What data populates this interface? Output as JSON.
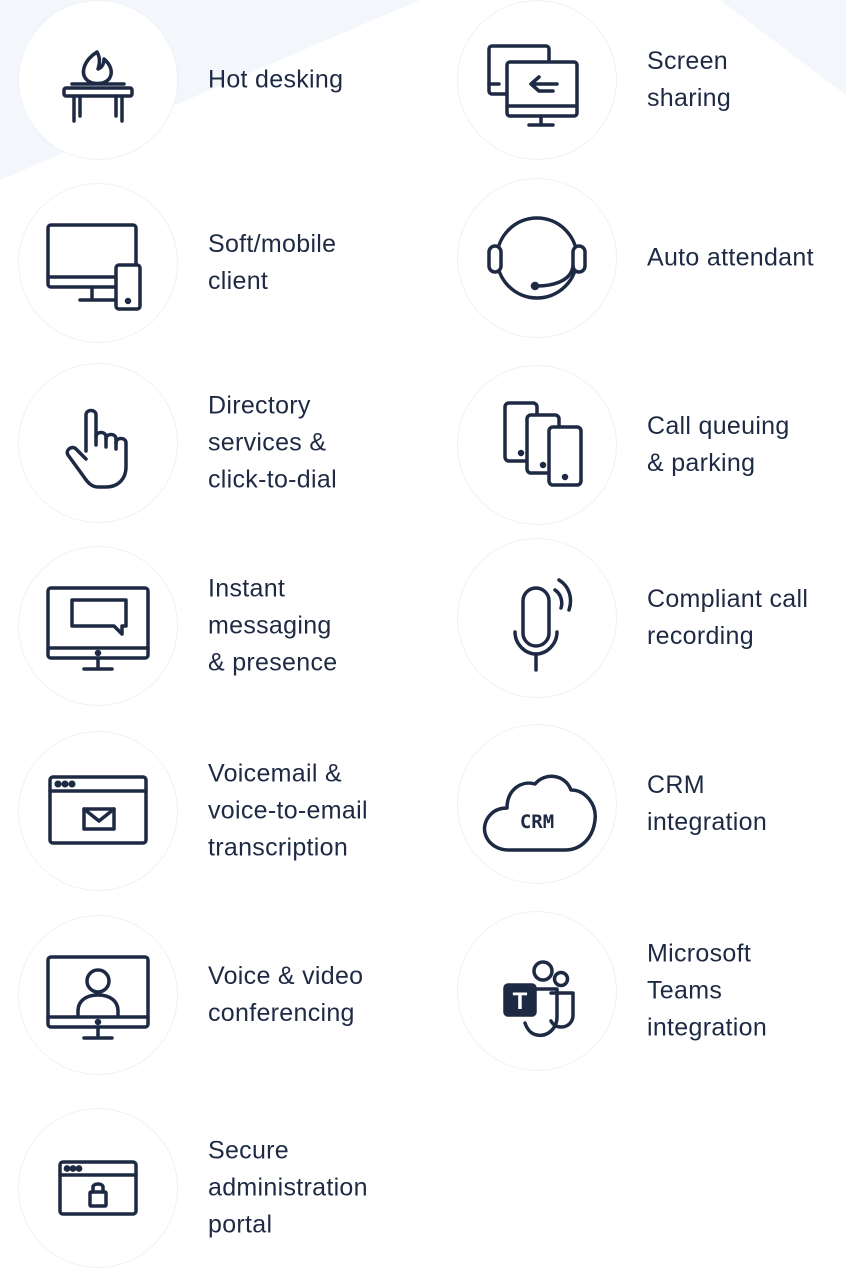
{
  "colors": {
    "text": "#1e2a44",
    "icon": "#1e2a44",
    "circle_background": "#ffffff",
    "page_background_tint": "#f3f6fb"
  },
  "features": [
    {
      "icon": "flame-on-table-icon",
      "lines": [
        "Hot desking"
      ]
    },
    {
      "icon": "screen-sharing-icon",
      "lines": [
        "Screen",
        "sharing"
      ]
    },
    {
      "icon": "monitor-and-phone-icon",
      "lines": [
        "Soft/mobile",
        "client"
      ]
    },
    {
      "icon": "headset-icon",
      "lines": [
        "Auto attendant"
      ]
    },
    {
      "icon": "pointing-hand-icon",
      "lines": [
        "Directory",
        "services &",
        "click-to-dial"
      ]
    },
    {
      "icon": "stacked-phones-icon",
      "lines": [
        "Call queuing",
        "& parking"
      ]
    },
    {
      "icon": "chat-monitor-icon",
      "lines": [
        "Instant",
        "messaging",
        "& presence"
      ]
    },
    {
      "icon": "microphone-icon",
      "lines": [
        "Compliant call",
        "recording"
      ]
    },
    {
      "icon": "email-window-icon",
      "lines": [
        "Voicemail &",
        "voice-to-email",
        "transcription"
      ]
    },
    {
      "icon": "crm-cloud-icon",
      "lines": [
        "CRM",
        "integration"
      ],
      "icon_text": "CRM"
    },
    {
      "icon": "video-call-monitor-icon",
      "lines": [
        "Voice & video",
        "conferencing"
      ]
    },
    {
      "icon": "microsoft-teams-icon",
      "lines": [
        "Microsoft",
        "Teams",
        "integration"
      ],
      "icon_text": "T"
    },
    {
      "icon": "secure-portal-icon",
      "lines": [
        "Secure",
        "administration",
        "portal"
      ]
    }
  ]
}
